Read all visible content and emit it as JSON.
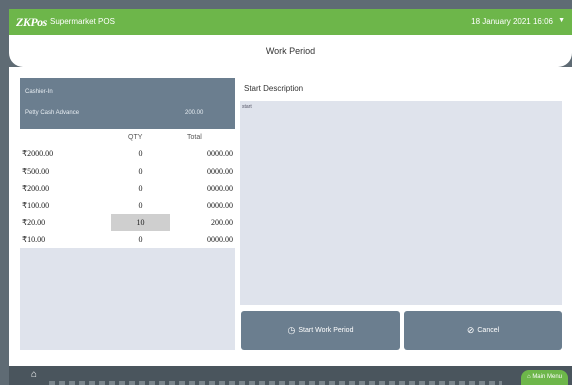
{
  "app": {
    "logo": "ZKPos",
    "title": "Supermarket POS",
    "datetime": "18 January 2021 16:06"
  },
  "page_title": "Work Period",
  "cash_panel": {
    "cashier": "Cashier-In",
    "petty_label": "Petty Cash Advance",
    "petty_value": "200.00"
  },
  "table": {
    "headers": {
      "qty": "QTY",
      "total": "Total"
    },
    "rows": [
      {
        "denomination": "₹2000.00",
        "qty": "0",
        "total": "0000.00"
      },
      {
        "denomination": "₹500.00",
        "qty": "0",
        "total": "0000.00"
      },
      {
        "denomination": "₹200.00",
        "qty": "0",
        "total": "0000.00"
      },
      {
        "denomination": "₹100.00",
        "qty": "0",
        "total": "0000.00"
      },
      {
        "denomination": "₹20.00",
        "qty": "10",
        "total": "200.00"
      },
      {
        "denomination": "₹10.00",
        "qty": "0",
        "total": "0000.00"
      }
    ]
  },
  "description": {
    "label": "Start Description",
    "value": "start"
  },
  "buttons": {
    "start": "Start Work Period",
    "cancel": "Cancel"
  },
  "bottom": {
    "menu": "Main Menu"
  },
  "colors": {
    "accent": "#6db64a",
    "panel": "#6b7e8f",
    "field": "#dfe3ec"
  }
}
